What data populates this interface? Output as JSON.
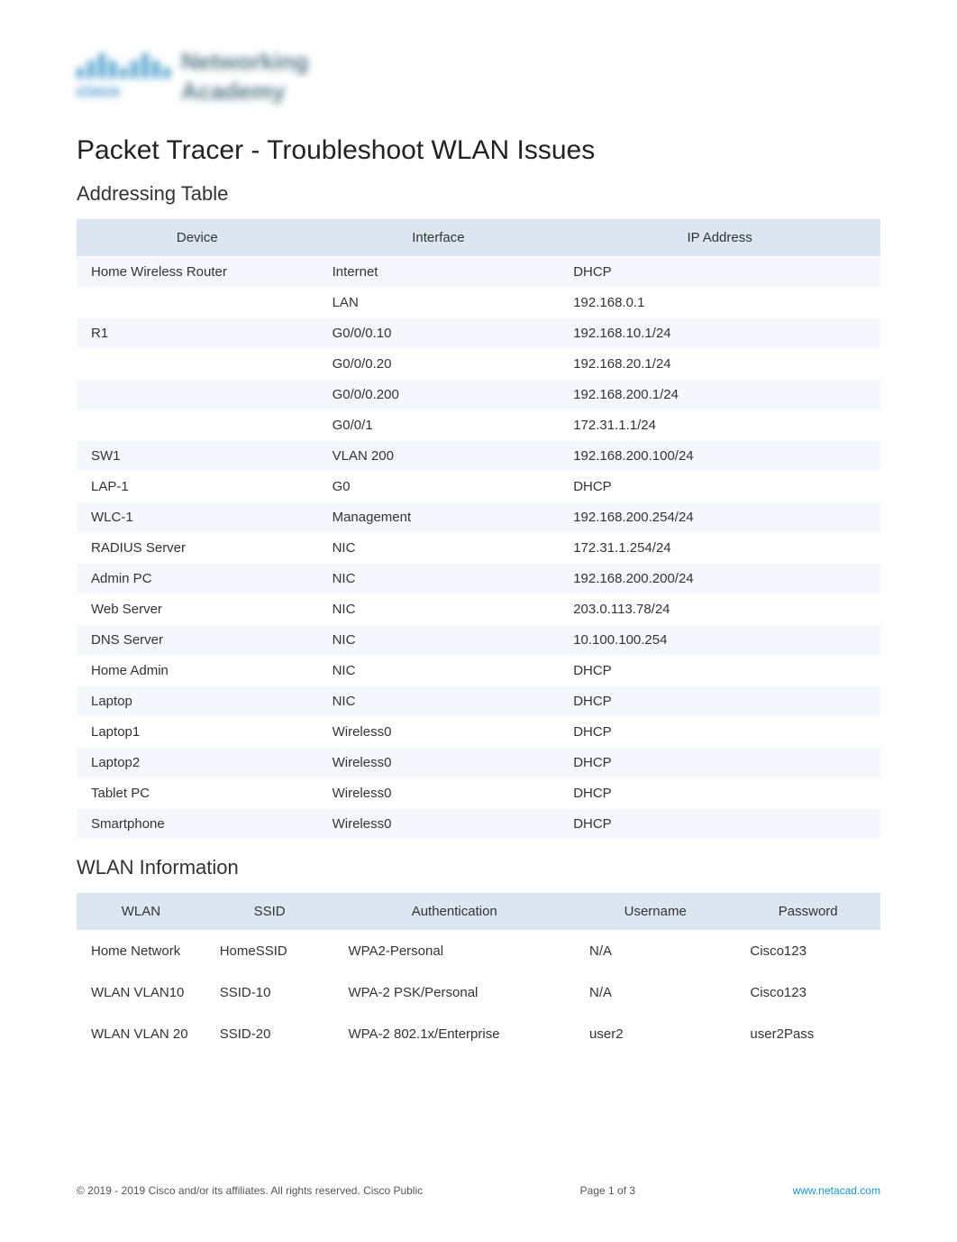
{
  "logo": {
    "brand": "cisco",
    "line1": "Networking",
    "line2": "Academy"
  },
  "title": "Packet Tracer - Troubleshoot WLAN Issues",
  "sections": {
    "addressing": "Addressing Table",
    "wlaninfo": "WLAN Information"
  },
  "addressing_table": {
    "headers": [
      "Device",
      "Interface",
      "IP Address"
    ],
    "rows": [
      {
        "device": "Home Wireless Router",
        "interface": "Internet",
        "ip": "DHCP"
      },
      {
        "device": "",
        "interface": "LAN",
        "ip": "192.168.0.1"
      },
      {
        "device": "R1",
        "interface": "G0/0/0.10",
        "ip": "192.168.10.1/24"
      },
      {
        "device": "",
        "interface": "G0/0/0.20",
        "ip": "192.168.20.1/24"
      },
      {
        "device": "",
        "interface": "G0/0/0.200",
        "ip": "192.168.200.1/24"
      },
      {
        "device": "",
        "interface": "G0/0/1",
        "ip": "172.31.1.1/24"
      },
      {
        "device": "SW1",
        "interface": "VLAN 200",
        "ip": "192.168.200.100/24"
      },
      {
        "device": "LAP-1",
        "interface": "G0",
        "ip": "DHCP"
      },
      {
        "device": "WLC-1",
        "interface": "Management",
        "ip": "192.168.200.254/24"
      },
      {
        "device": "RADIUS Server",
        "interface": "NIC",
        "ip": "172.31.1.254/24"
      },
      {
        "device": "Admin PC",
        "interface": "NIC",
        "ip": "192.168.200.200/24"
      },
      {
        "device": "Web Server",
        "interface": "NIC",
        "ip": "203.0.113.78/24"
      },
      {
        "device": "DNS Server",
        "interface": "NIC",
        "ip": "10.100.100.254"
      },
      {
        "device": "Home Admin",
        "interface": "NIC",
        "ip": "DHCP"
      },
      {
        "device": "Laptop",
        "interface": "NIC",
        "ip": "DHCP"
      },
      {
        "device": "Laptop1",
        "interface": "Wireless0",
        "ip": "DHCP"
      },
      {
        "device": "Laptop2",
        "interface": "Wireless0",
        "ip": "DHCP"
      },
      {
        "device": "Tablet PC",
        "interface": "Wireless0",
        "ip": "DHCP"
      },
      {
        "device": "Smartphone",
        "interface": "Wireless0",
        "ip": "DHCP"
      }
    ]
  },
  "wlan_table": {
    "headers": [
      "WLAN",
      "SSID",
      "Authentication",
      "Username",
      "Password"
    ],
    "rows": [
      {
        "wlan": "Home Network",
        "ssid": "HomeSSID",
        "auth": "WPA2-Personal",
        "user": "N/A",
        "pass": "Cisco123"
      },
      {
        "wlan": "WLAN VLAN10",
        "ssid": "SSID-10",
        "auth": "WPA-2 PSK/Personal",
        "user": "N/A",
        "pass": "Cisco123"
      },
      {
        "wlan": "WLAN VLAN 20",
        "ssid": "SSID-20",
        "auth": "WPA-2 802.1x/Enterprise",
        "user": "user2",
        "pass": "user2Pass"
      }
    ]
  },
  "footer": {
    "copyright": "© 2019 - 2019 Cisco and/or its affiliates. All rights reserved. Cisco Public",
    "page": "Page  1 of 3",
    "link": "www.netacad.com"
  }
}
